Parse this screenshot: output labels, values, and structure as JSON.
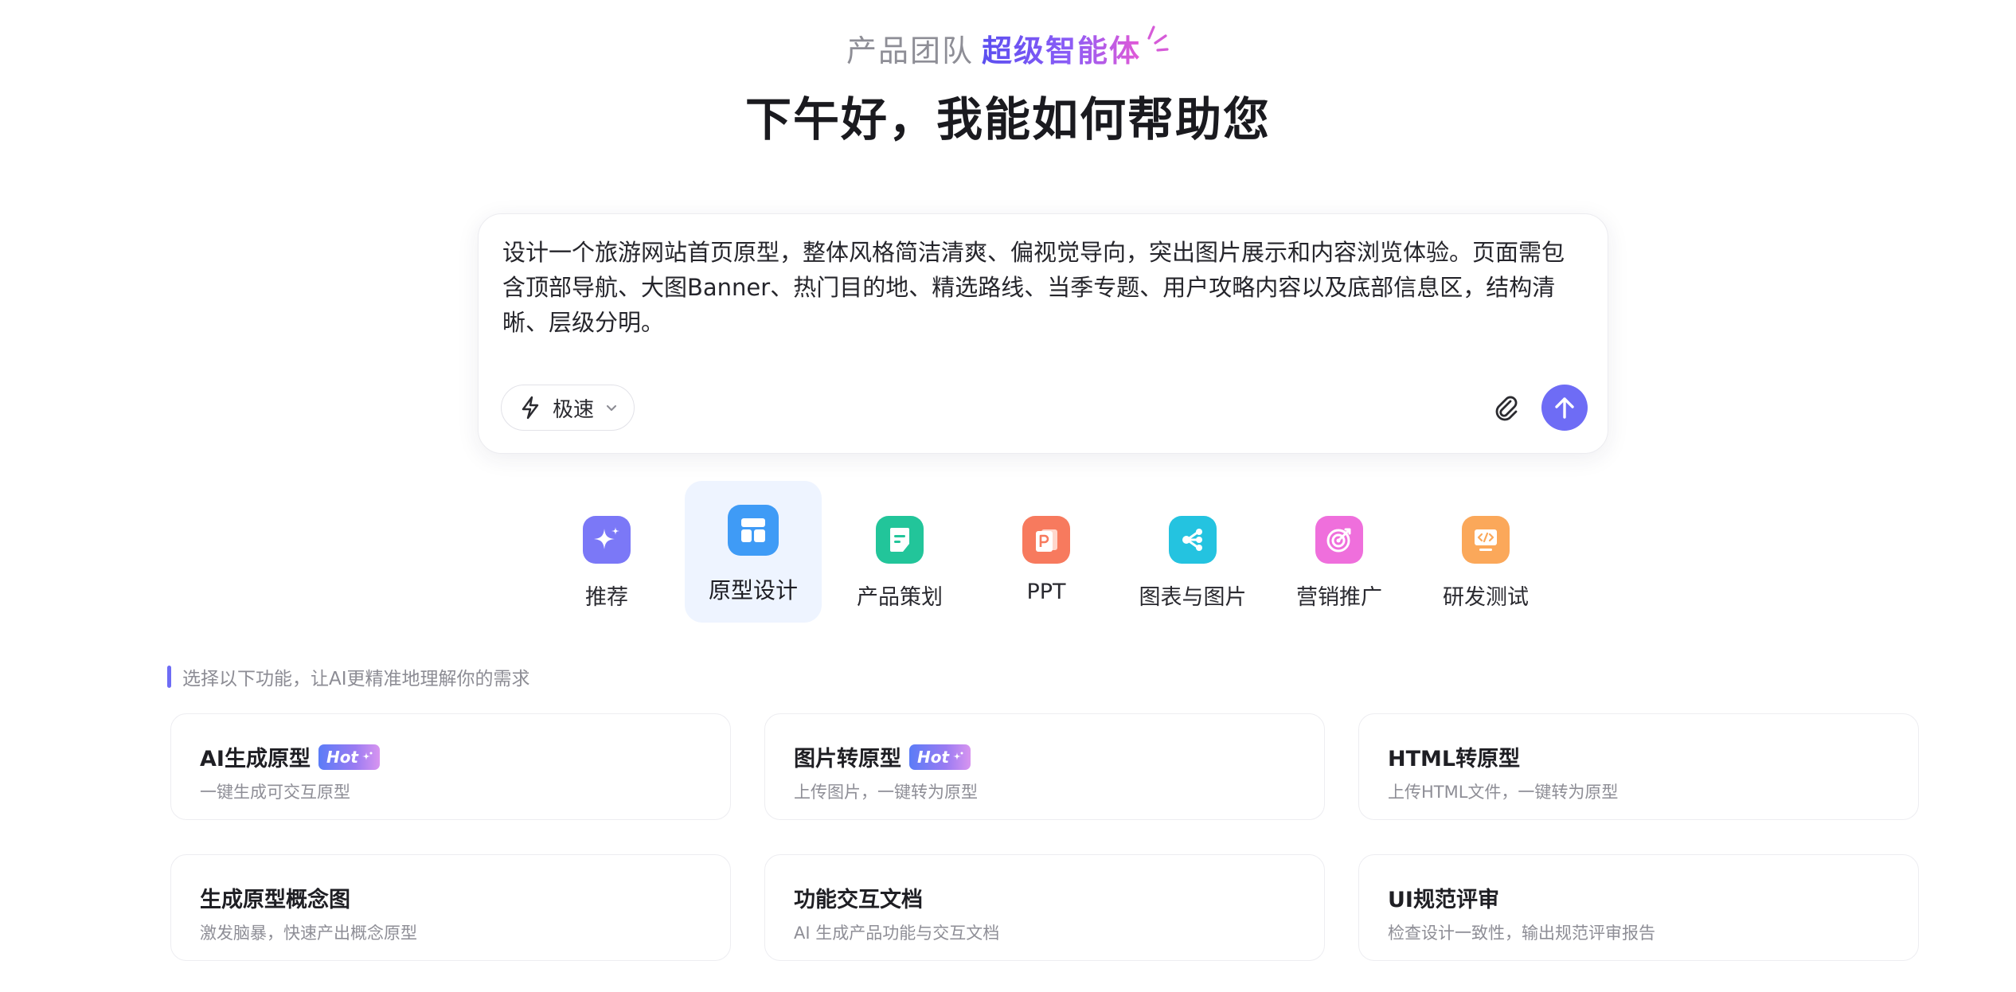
{
  "header": {
    "team": "产品团队",
    "agent": "超级智能体",
    "greeting": "下午好，我能如何帮助您"
  },
  "prompt": {
    "text": "设计一个旅游网站首页原型，整体风格简洁清爽、偏视觉导向，突出图片展示和内容浏览体验。页面需包含顶部导航、大图Banner、热门目的地、精选路线、当季专题、用户攻略内容以及底部信息区，结构清晰、层级分明。",
    "mode_label": "极速"
  },
  "categories": [
    {
      "label": "推荐",
      "icon": "sparkle-icon",
      "color": "#7b78f7",
      "active": false
    },
    {
      "label": "原型设计",
      "icon": "layout-icon",
      "color": "#3f9bf6",
      "active": true
    },
    {
      "label": "产品策划",
      "icon": "document-icon",
      "color": "#22c59a",
      "active": false
    },
    {
      "label": "PPT",
      "icon": "ppt-icon",
      "color": "#f77a5e",
      "active": false
    },
    {
      "label": "图表与图片",
      "icon": "share-nodes-icon",
      "color": "#24c3e0",
      "active": false
    },
    {
      "label": "营销推广",
      "icon": "target-icon",
      "color": "#ef6fdc",
      "active": false
    },
    {
      "label": "研发测试",
      "icon": "code-monitor-icon",
      "color": "#fba85a",
      "active": false
    }
  ],
  "hint": "选择以下功能，让AI更精准地理解你的需求",
  "features": [
    {
      "title": "AI生成原型",
      "desc": "一键生成可交互原型",
      "hot": true
    },
    {
      "title": "图片转原型",
      "desc": "上传图片，一键转为原型",
      "hot": true
    },
    {
      "title": "HTML转原型",
      "desc": "上传HTML文件，一键转为原型",
      "hot": false
    },
    {
      "title": "生成原型概念图",
      "desc": "激发脑暴，快速产出概念原型",
      "hot": false
    },
    {
      "title": "功能交互文档",
      "desc": "AI 生成产品功能与交互文档",
      "hot": false
    },
    {
      "title": "UI规范评审",
      "desc": "检查设计一致性，输出规范评审报告",
      "hot": false
    }
  ],
  "badge": {
    "hot_label": "Hot"
  },
  "colors": {
    "accent": "#6e6cf5",
    "active_tab_bg": "#eef4ff"
  }
}
